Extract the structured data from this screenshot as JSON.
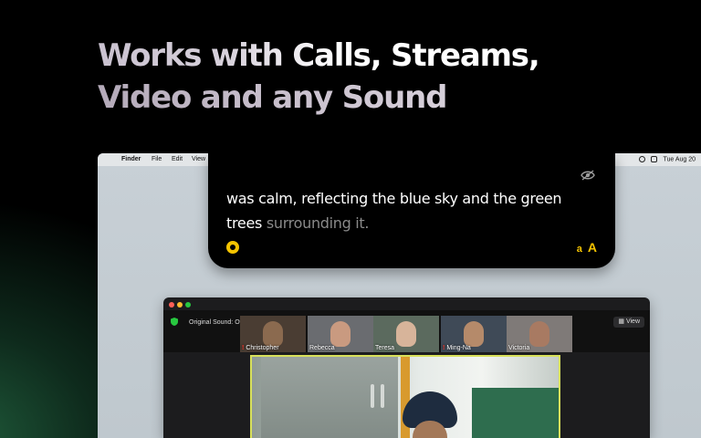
{
  "headline": {
    "line1": "Works with Calls, Streams,",
    "line2": "Video and any Sound"
  },
  "menubar": {
    "apple": "",
    "items": [
      "Finder",
      "File",
      "Edit",
      "View"
    ],
    "clock": "Tue Aug 20"
  },
  "caption": {
    "text_main": "was calm, reflecting the blue sky and the green trees ",
    "text_faded": "surrounding it.",
    "font_small": "a",
    "font_large": "A",
    "accent_color": "#f5c400"
  },
  "call": {
    "original_sound": "Original Sound: Off",
    "view_label": "View",
    "participants": [
      {
        "name": "Christopher",
        "muted": true
      },
      {
        "name": "Rebecca",
        "muted": false
      },
      {
        "name": "Teresa",
        "muted": false
      },
      {
        "name": "Ming-Na",
        "muted": true
      },
      {
        "name": "Victoria",
        "muted": false
      }
    ],
    "active_speaker_border": "#d8e05a"
  }
}
